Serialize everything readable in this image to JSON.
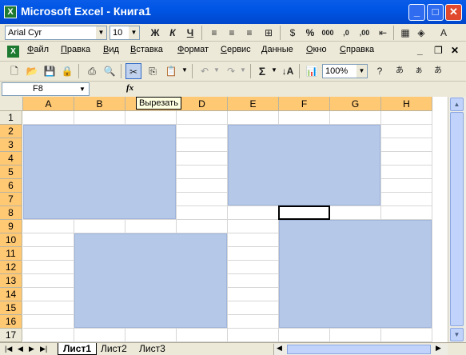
{
  "window": {
    "title": "Microsoft Excel - Книга1",
    "icon": "excel-icon"
  },
  "format_toolbar": {
    "font_name": "Arial Cyr",
    "font_size": "10",
    "bold_label": "Ж",
    "italic_label": "К",
    "underline_label": "Ч",
    "percent_label": "%",
    "comma_label": "000",
    "inc_decimal_label": ",0",
    "dec_decimal_label": ",00"
  },
  "menu": {
    "items": [
      "Файл",
      "Правка",
      "Вид",
      "Вставка",
      "Формат",
      "Сервис",
      "Данные",
      "Окно",
      "Справка"
    ]
  },
  "standard_toolbar": {
    "zoom": "100%",
    "sigma_label": "Σ"
  },
  "formula_bar": {
    "name_box": "F8",
    "fx_label": "fx"
  },
  "tooltip": "Вырезать",
  "grid": {
    "columns": [
      "A",
      "B",
      "C",
      "D",
      "E",
      "F",
      "G",
      "H"
    ],
    "rows": [
      "1",
      "2",
      "3",
      "4",
      "5",
      "6",
      "7",
      "8",
      "9",
      "10",
      "11",
      "12",
      "13",
      "14",
      "15",
      "16",
      "17"
    ],
    "active_cell": "F8",
    "selections": [
      "A2:C8",
      "E2:G7",
      "B10:D16",
      "F9:H16"
    ],
    "selection_color": "#b5c8e8"
  },
  "sheets": {
    "tabs": [
      "Лист1",
      "Лист2",
      "Лист3"
    ],
    "active": "Лист1"
  },
  "colors": {
    "title_bar": "#0055e5",
    "close_button": "#e0492d",
    "header_selected": "#ffc873"
  }
}
